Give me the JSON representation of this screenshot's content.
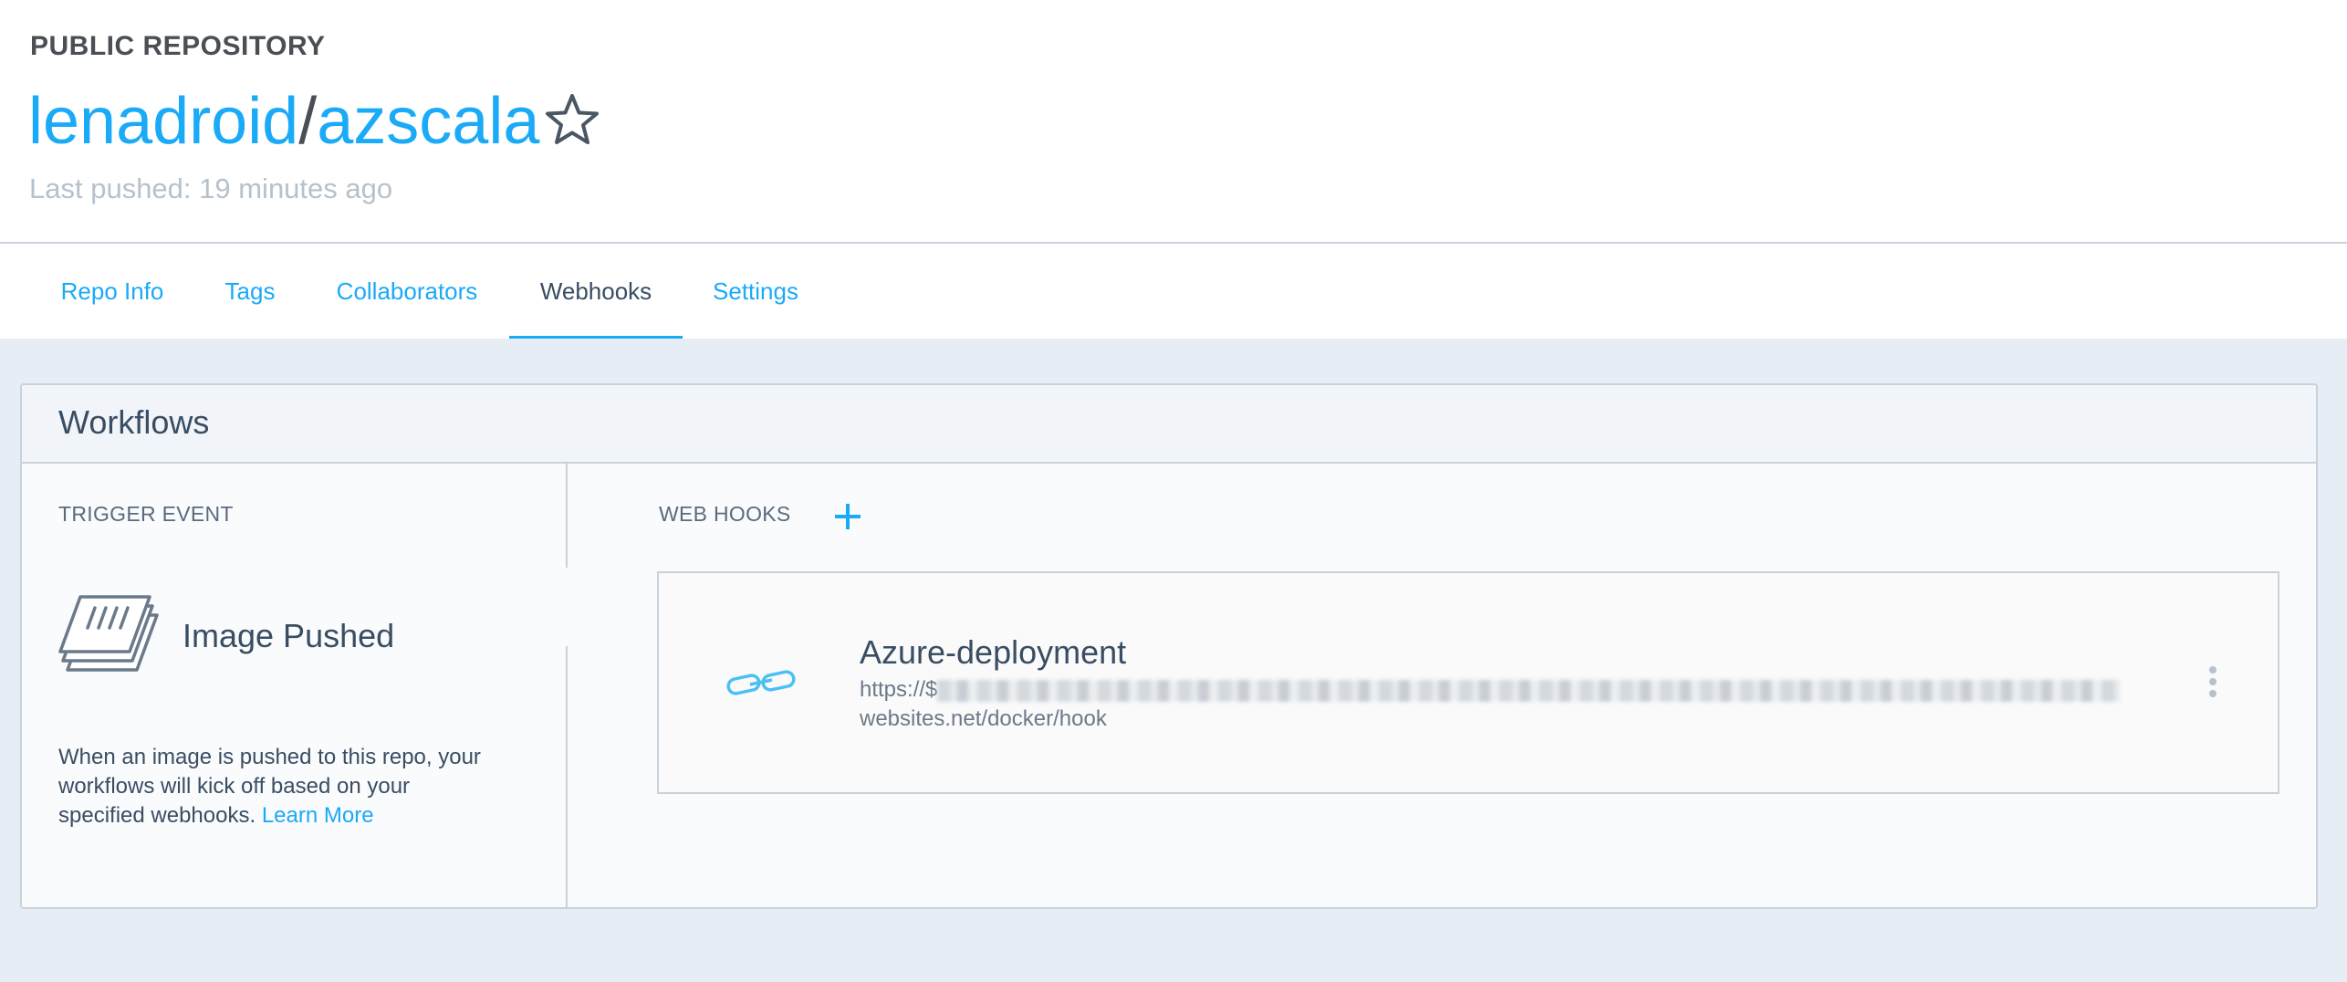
{
  "repo": {
    "visibility": "PUBLIC REPOSITORY",
    "namespace": "lenadroid",
    "separator": "/",
    "name": "azscala",
    "last_pushed": "Last pushed: 19 minutes ago"
  },
  "tabs": [
    {
      "label": "Repo Info",
      "active": false
    },
    {
      "label": "Tags",
      "active": false
    },
    {
      "label": "Collaborators",
      "active": false
    },
    {
      "label": "Webhooks",
      "active": true
    },
    {
      "label": "Settings",
      "active": false
    }
  ],
  "workflows": {
    "title": "Workflows",
    "trigger": {
      "section_label": "TRIGGER EVENT",
      "event_name": "Image Pushed",
      "description": "When an image is pushed to this repo, your workflows will kick off based on your specified webhooks.",
      "learn_more": "Learn More",
      "icon": "stacked-layers-icon"
    },
    "webhooks": {
      "section_label": "WEB HOOKS",
      "items": [
        {
          "name": "Azure-deployment",
          "url_prefix": "https://$",
          "url_suffix": "websites.net/docker/hook",
          "icon": "link-icon"
        }
      ]
    }
  },
  "colors": {
    "accent": "#1aaaf8",
    "text": "#394d63",
    "muted": "#b6c1cc",
    "background": "#e7edf5",
    "border": "#c9d2db"
  }
}
